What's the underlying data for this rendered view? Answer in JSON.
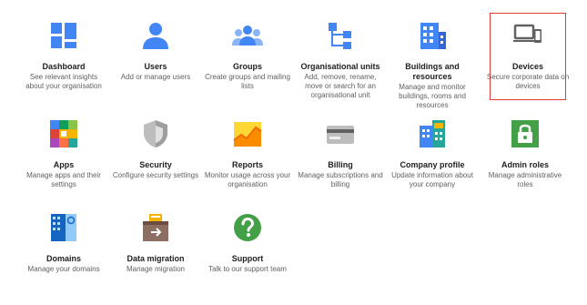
{
  "cards": [
    {
      "title": "Dashboard",
      "desc": "See relevant insights about your organisation",
      "icon": "dashboard-icon"
    },
    {
      "title": "Users",
      "desc": "Add or manage users",
      "icon": "user-icon"
    },
    {
      "title": "Groups",
      "desc": "Create groups and mailing lists",
      "icon": "groups-icon"
    },
    {
      "title": "Organisational units",
      "desc": "Add, remove, rename, move or search for an organisational unit",
      "icon": "org-units-icon"
    },
    {
      "title": "Buildings and resources",
      "desc": "Manage and monitor buildings, rooms and resources",
      "icon": "building-icon"
    },
    {
      "title": "Devices",
      "desc": "Secure corporate data on devices",
      "icon": "devices-icon"
    },
    {
      "title": "Apps",
      "desc": "Manage apps and their settings",
      "icon": "apps-icon"
    },
    {
      "title": "Security",
      "desc": "Configure security settings",
      "icon": "shield-icon"
    },
    {
      "title": "Reports",
      "desc": "Monitor usage across your organisation",
      "icon": "reports-chart-icon"
    },
    {
      "title": "Billing",
      "desc": "Manage subscriptions and billing",
      "icon": "credit-card-icon"
    },
    {
      "title": "Company profile",
      "desc": "Update information about your company",
      "icon": "company-building-icon"
    },
    {
      "title": "Admin roles",
      "desc": "Manage administrative roles",
      "icon": "lock-icon"
    },
    {
      "title": "Domains",
      "desc": "Manage your domains",
      "icon": "domains-icon"
    },
    {
      "title": "Data migration",
      "desc": "Manage migration",
      "icon": "data-migration-icon"
    },
    {
      "title": "Support",
      "desc": "Talk to our support team",
      "icon": "help-icon"
    }
  ],
  "selected_card": "Devices",
  "colors": {
    "blue": "#4285f4",
    "dark_blue": "#3367d6",
    "green": "#0f9d58",
    "yellow": "#f4b400",
    "red": "#db4437",
    "grey": "#9e9e9e",
    "highlight": "#e53935"
  }
}
